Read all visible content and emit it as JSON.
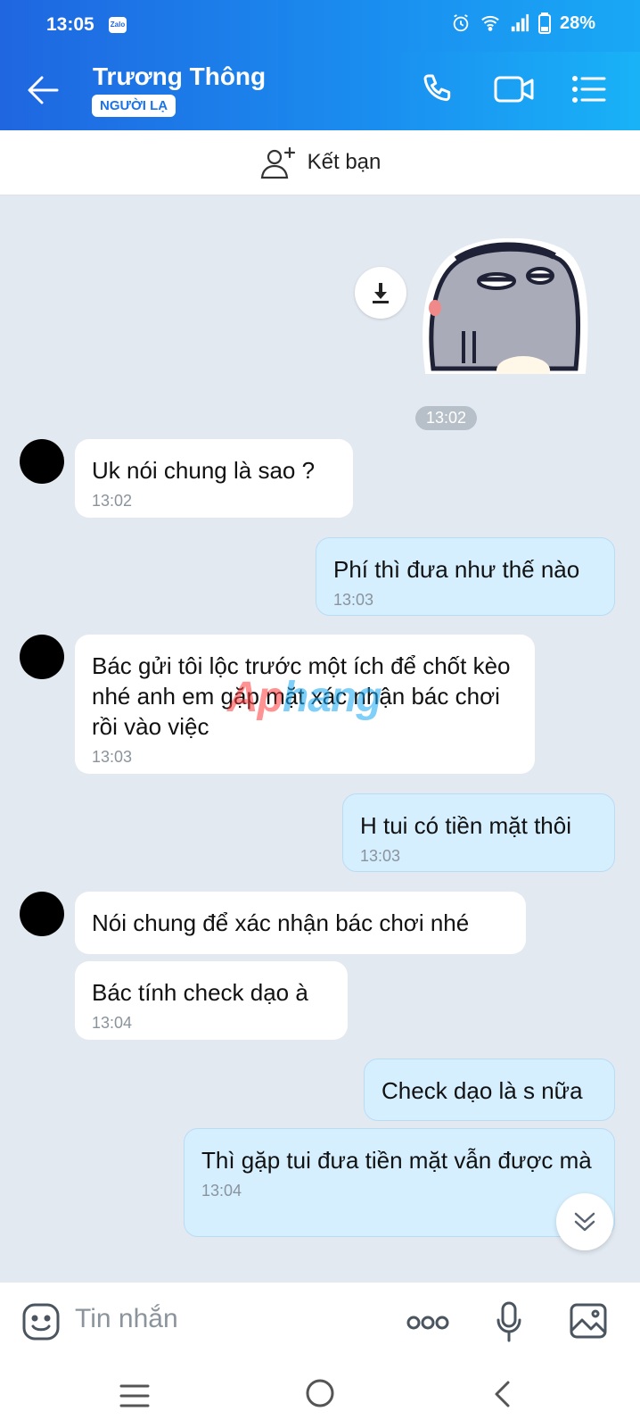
{
  "status_bar": {
    "time": "13:05",
    "app_badge": "Zalo",
    "battery": "28%"
  },
  "header": {
    "contact_name": "Trương Thông",
    "stranger_badge": "NGƯỜI LẠ"
  },
  "add_friend": {
    "label": "Kết bạn"
  },
  "chat": {
    "sticker_time": "13:02",
    "watermark_part1": "Ap",
    "watermark_part2": "hang",
    "messages": [
      {
        "dir": "in",
        "text": "Uk nói chung là sao ?",
        "time": "13:02"
      },
      {
        "dir": "out",
        "text": "Phí thì đưa như thế nào",
        "time": "13:03"
      },
      {
        "dir": "in",
        "text": "Bác gửi tôi lộc trước một ích để chốt kèo nhé anh em gặp mặt xác nhận bác chơi rồi vào việc",
        "time": "13:03"
      },
      {
        "dir": "out",
        "text": "H tui có tiền mặt thôi",
        "time": "13:03"
      },
      {
        "dir": "in",
        "text": "Nói chung để xác nhận bác chơi nhé",
        "time": ""
      },
      {
        "dir": "in",
        "text": "Bác tính check dạo à",
        "time": "13:04"
      },
      {
        "dir": "out",
        "text": "Check dạo là s nữa",
        "time": ""
      },
      {
        "dir": "out",
        "text": "Thì gặp tui đưa tiền mặt vẫn được mà",
        "time": "13:04"
      }
    ]
  },
  "input": {
    "placeholder": "Tin nhắn"
  },
  "colors": {
    "header_start": "#1f66e0",
    "header_end": "#19b2f7",
    "incoming_bubble": "#ffffff",
    "outgoing_bubble": "#d5efff",
    "chat_bg": "#e2e9f1"
  }
}
